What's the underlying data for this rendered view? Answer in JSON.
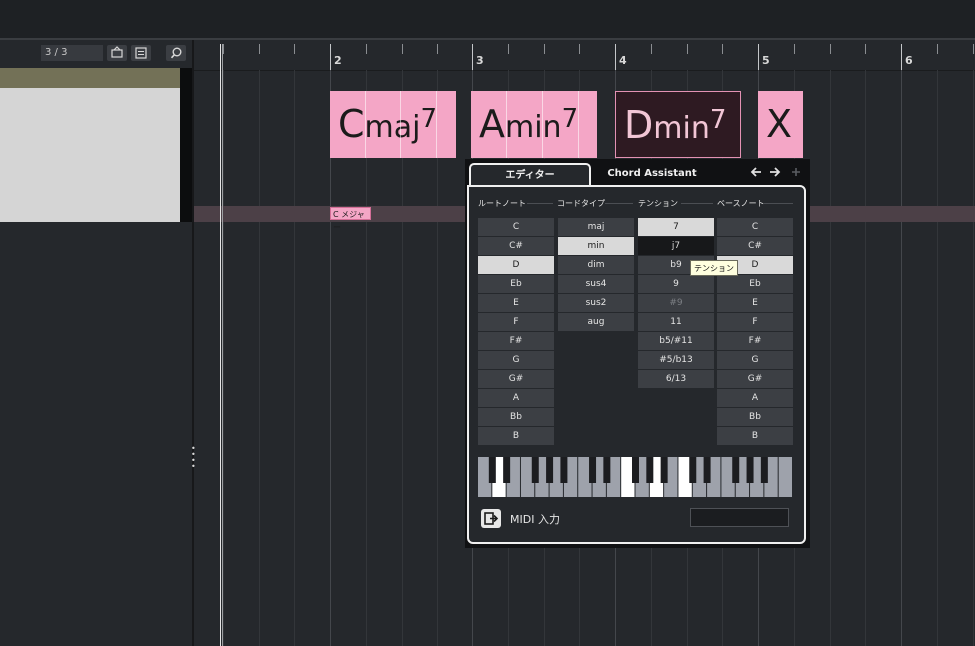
{
  "toolbar": {
    "track_count": "3 / 3"
  },
  "ruler": {
    "bars": [
      "2",
      "3",
      "4",
      "5",
      "6"
    ]
  },
  "chords": [
    {
      "root": "C",
      "type": "maj",
      "tension": "7"
    },
    {
      "root": "A",
      "type": "min",
      "tension": "7"
    },
    {
      "root": "D",
      "type": "min",
      "tension": "7"
    },
    {
      "root": "X",
      "type": "",
      "tension": ""
    }
  ],
  "scale_event": {
    "label": "C メジャー"
  },
  "editor": {
    "tab_editor": "エディター",
    "tab_assistant": "Chord Assistant",
    "columns": {
      "root": {
        "header": "ルートノート",
        "items": [
          "C",
          "C#",
          "D",
          "Eb",
          "E",
          "F",
          "F#",
          "G",
          "G#",
          "A",
          "Bb",
          "B"
        ]
      },
      "type": {
        "header": "コードタイプ",
        "items": [
          "maj",
          "min",
          "dim",
          "sus4",
          "sus2",
          "aug"
        ]
      },
      "tension": {
        "header": "テンション",
        "items": [
          "7",
          "j7",
          "b9",
          "9",
          "#9",
          "11",
          "b5/#11",
          "#5/b13",
          "6/13"
        ]
      },
      "bass": {
        "header": "ベースノート",
        "items": [
          "C",
          "C#",
          "D",
          "Eb",
          "E",
          "F",
          "F#",
          "G",
          "G#",
          "A",
          "Bb",
          "B"
        ]
      }
    },
    "tooltip": "テンション",
    "midi_label": "MIDI 入力",
    "midi_value": ""
  },
  "colors": {
    "chord": "#f4a6c6",
    "chord_selected": "#2e1a22",
    "track_header": "#737157"
  }
}
